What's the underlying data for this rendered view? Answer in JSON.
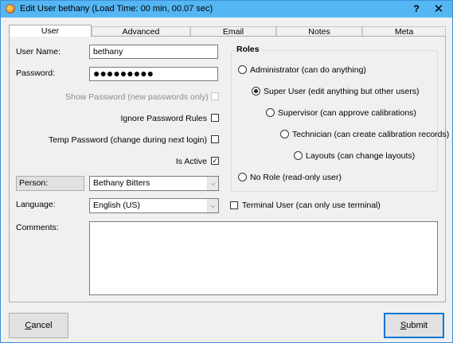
{
  "window": {
    "title": "Edit User bethany (Load Time: 00 min, 00.07 sec)",
    "help_label": "?",
    "close_label": "✕",
    "titlebar_color": "#55b6f4",
    "accent_color": "#0078d7"
  },
  "tabs": [
    {
      "label": "User",
      "active": true
    },
    {
      "label": "Advanced",
      "active": false
    },
    {
      "label": "Email",
      "active": false
    },
    {
      "label": "Notes",
      "active": false
    },
    {
      "label": "Meta",
      "active": false
    }
  ],
  "form": {
    "username_label": "User Name:",
    "username_value": "bethany",
    "password_label": "Password:",
    "password_mask": "●●●●●●●●●",
    "show_password_label": "Show Password (new passwords only)",
    "show_password_checked": false,
    "ignore_rules_label": "Ignore Password Rules",
    "ignore_rules_checked": false,
    "temp_password_label": "Temp Password (change during next login)",
    "temp_password_checked": false,
    "is_active_label": "Is Active",
    "is_active_checked": true,
    "is_active_mark": "✓",
    "person_button_label": "Person:",
    "person_value": "Bethany Bitters",
    "language_label": "Language:",
    "language_value": "English (US)",
    "terminal_user_label": "Terminal User (can only use terminal)",
    "terminal_user_checked": false,
    "comments_label": "Comments:",
    "comments_value": "",
    "dropdown_glyph": "⌵"
  },
  "roles": {
    "title": "Roles",
    "options": [
      {
        "label": "Administrator (can do anything)",
        "checked": false
      },
      {
        "label": "Super User (edit anything but other users)",
        "checked": true
      },
      {
        "label": "Supervisor (can approve calibrations)",
        "checked": false
      },
      {
        "label": "Technician (can create calibration records)",
        "checked": false
      },
      {
        "label": "Layouts (can change layouts)",
        "checked": false
      },
      {
        "label": "No Role (read-only user)",
        "checked": false
      }
    ]
  },
  "buttons": {
    "cancel_label": "Cancel",
    "submit_label": "Submit"
  }
}
